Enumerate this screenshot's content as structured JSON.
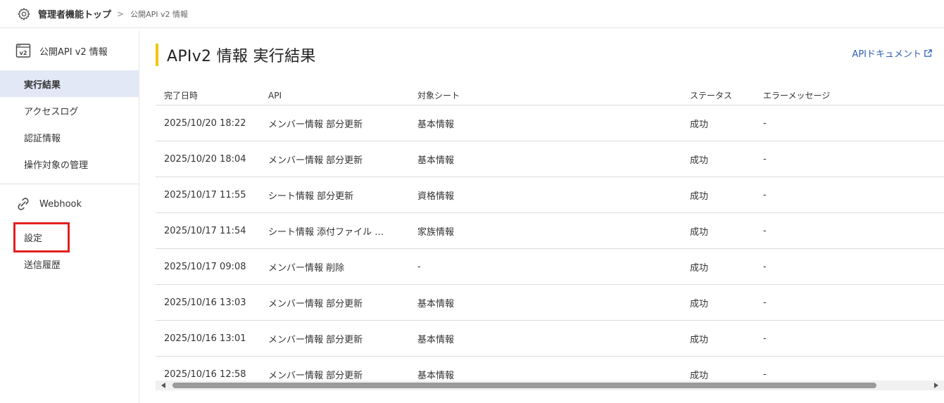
{
  "breadcrumb": {
    "root": "管理者機能トップ",
    "separator": ">",
    "current": "公開API v2 情報"
  },
  "sidebar": {
    "section1": {
      "icon": "api-v2-icon",
      "title": "公開API v2 情報",
      "items": [
        "実行結果",
        "アクセスログ",
        "認証情報",
        "操作対象の管理"
      ]
    },
    "section2": {
      "icon": "link-icon",
      "title": "Webhook",
      "items": [
        "設定",
        "送信履歴"
      ]
    }
  },
  "main": {
    "title": "APIv2 情報 実行結果",
    "doc_link": "APIドキュメント",
    "columns": [
      "完了日時",
      "API",
      "対象シート",
      "ステータス",
      "エラーメッセージ"
    ],
    "rows": [
      {
        "date": "2025/10/20 18:22",
        "api": "メンバー情報 部分更新",
        "sheet": "基本情報",
        "status": "成功",
        "error": "-"
      },
      {
        "date": "2025/10/20 18:04",
        "api": "メンバー情報 部分更新",
        "sheet": "基本情報",
        "status": "成功",
        "error": "-"
      },
      {
        "date": "2025/10/17 11:55",
        "api": "シート情報 部分更新",
        "sheet": "資格情報",
        "status": "成功",
        "error": "-"
      },
      {
        "date": "2025/10/17 11:54",
        "api": "シート情報 添付ファイル …",
        "sheet": "家族情報",
        "status": "成功",
        "error": "-"
      },
      {
        "date": "2025/10/17 09:08",
        "api": "メンバー情報 削除",
        "sheet": "-",
        "status": "成功",
        "error": "-"
      },
      {
        "date": "2025/10/16 13:03",
        "api": "メンバー情報 部分更新",
        "sheet": "基本情報",
        "status": "成功",
        "error": "-"
      },
      {
        "date": "2025/10/16 13:01",
        "api": "メンバー情報 部分更新",
        "sheet": "基本情報",
        "status": "成功",
        "error": "-"
      },
      {
        "date": "2025/10/16 12:58",
        "api": "メンバー情報 部分更新",
        "sheet": "基本情報",
        "status": "成功",
        "error": "-"
      }
    ]
  },
  "colors": {
    "accent_bar": "#f2c700",
    "active_item_bg": "#e3e8f7",
    "link": "#2f5db5",
    "highlight_box": "#e02020"
  }
}
